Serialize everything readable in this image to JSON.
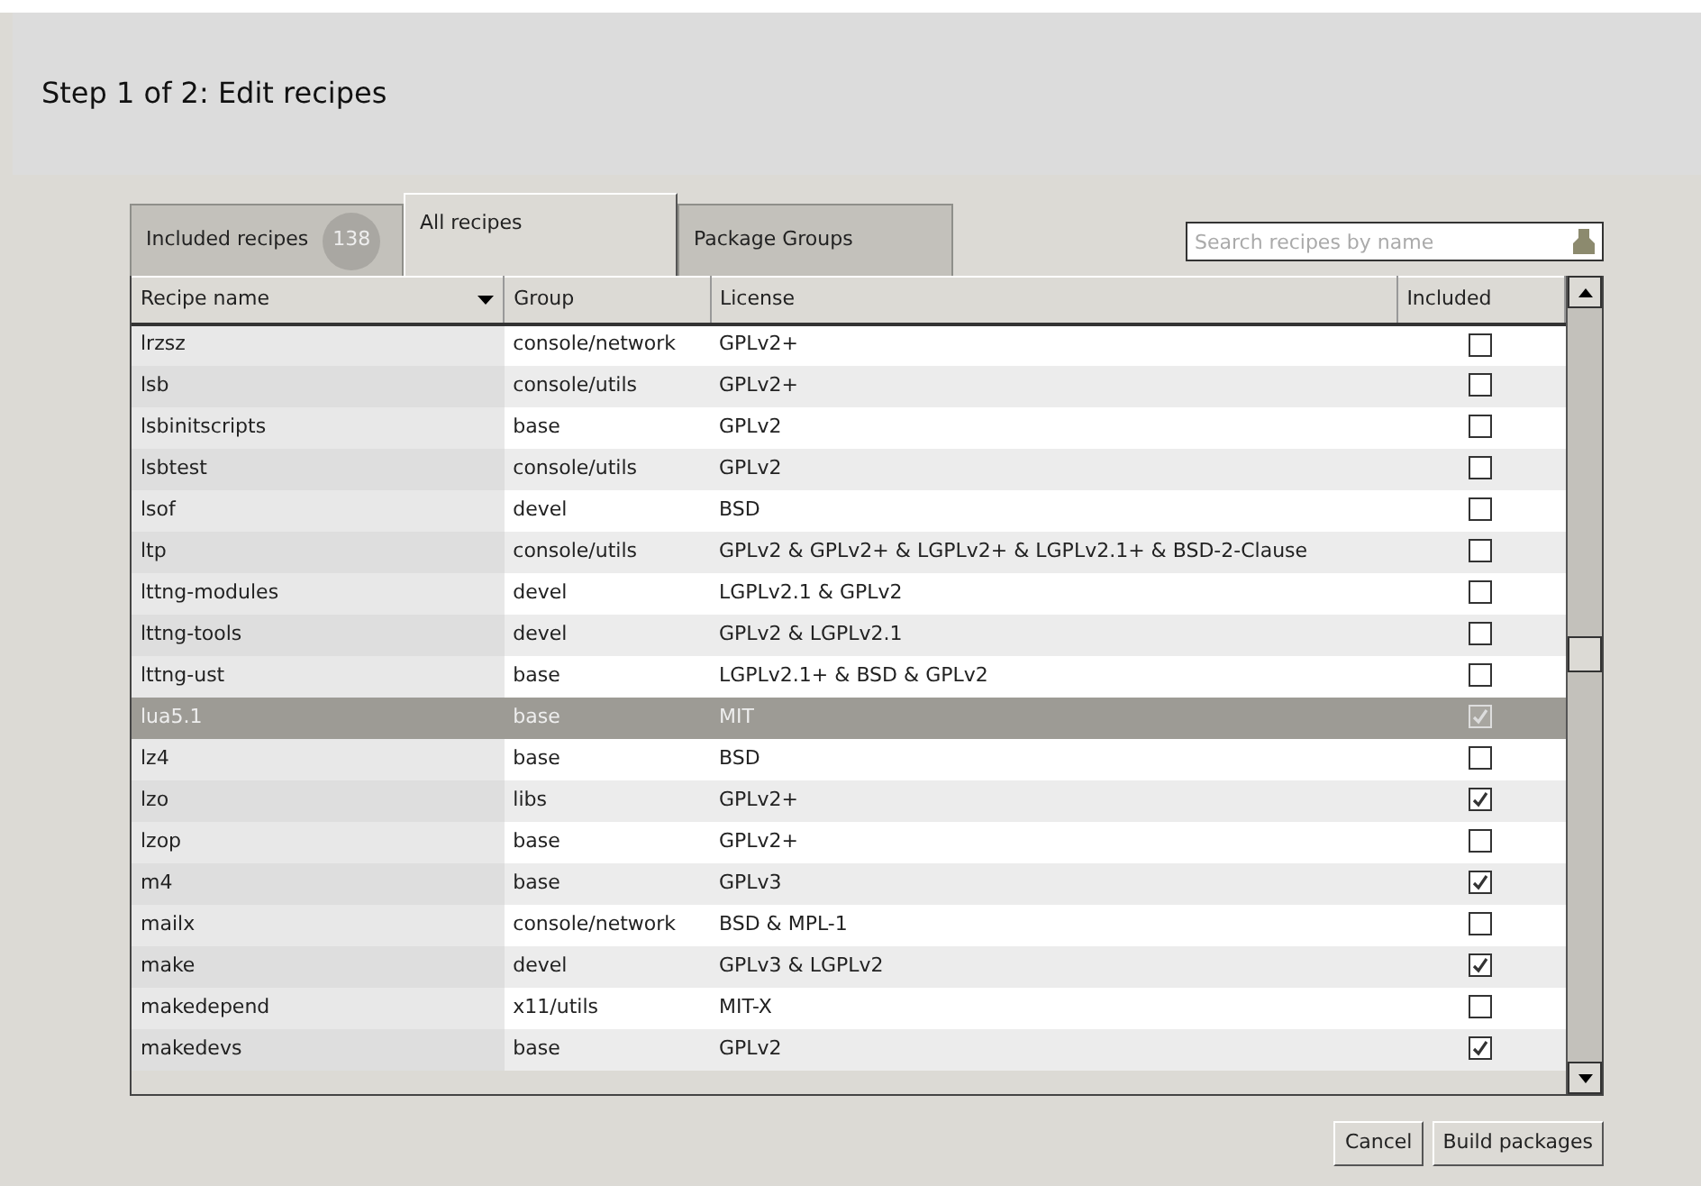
{
  "header": {
    "title": "Step 1 of 2: Edit recipes"
  },
  "tabs": [
    {
      "label": "Included recipes",
      "badge": "138",
      "selected": false
    },
    {
      "label": "All recipes",
      "selected": true
    },
    {
      "label": "Package Groups",
      "selected": false
    }
  ],
  "search": {
    "placeholder": "Search recipes by name"
  },
  "table": {
    "columns": [
      {
        "label": "Recipe name",
        "sorted": true
      },
      {
        "label": "Group",
        "sorted": false
      },
      {
        "label": "License",
        "sorted": false
      },
      {
        "label": "Included",
        "sorted": false
      }
    ],
    "rows": [
      {
        "name": "lrzsz",
        "group": "console/network",
        "license": "GPLv2+",
        "included": false,
        "selected": false
      },
      {
        "name": "lsb",
        "group": "console/utils",
        "license": "GPLv2+",
        "included": false,
        "selected": false
      },
      {
        "name": "lsbinitscripts",
        "group": "base",
        "license": "GPLv2",
        "included": false,
        "selected": false
      },
      {
        "name": "lsbtest",
        "group": "console/utils",
        "license": "GPLv2",
        "included": false,
        "selected": false
      },
      {
        "name": "lsof",
        "group": "devel",
        "license": "BSD",
        "included": false,
        "selected": false
      },
      {
        "name": "ltp",
        "group": "console/utils",
        "license": "GPLv2 & GPLv2+ & LGPLv2+ & LGPLv2.1+ & BSD-2-Clause",
        "included": false,
        "selected": false
      },
      {
        "name": "lttng-modules",
        "group": "devel",
        "license": "LGPLv2.1 & GPLv2",
        "included": false,
        "selected": false
      },
      {
        "name": "lttng-tools",
        "group": "devel",
        "license": "GPLv2 & LGPLv2.1",
        "included": false,
        "selected": false
      },
      {
        "name": "lttng-ust",
        "group": "base",
        "license": "LGPLv2.1+ & BSD & GPLv2",
        "included": false,
        "selected": false
      },
      {
        "name": "lua5.1",
        "group": "base",
        "license": "MIT",
        "included": true,
        "selected": true
      },
      {
        "name": "lz4",
        "group": "base",
        "license": "BSD",
        "included": false,
        "selected": false
      },
      {
        "name": "lzo",
        "group": "libs",
        "license": "GPLv2+",
        "included": true,
        "selected": false
      },
      {
        "name": "lzop",
        "group": "base",
        "license": "GPLv2+",
        "included": false,
        "selected": false
      },
      {
        "name": "m4",
        "group": "base",
        "license": "GPLv3",
        "included": true,
        "selected": false
      },
      {
        "name": "mailx",
        "group": "console/network",
        "license": "BSD & MPL-1",
        "included": false,
        "selected": false
      },
      {
        "name": "make",
        "group": "devel",
        "license": "GPLv3 & LGPLv2",
        "included": true,
        "selected": false
      },
      {
        "name": "makedepend",
        "group": "x11/utils",
        "license": "MIT-X",
        "included": false,
        "selected": false
      },
      {
        "name": "makedevs",
        "group": "base",
        "license": "GPLv2",
        "included": true,
        "selected": false
      }
    ]
  },
  "buttons": [
    {
      "label": "Cancel"
    },
    {
      "label": "Build packages"
    }
  ]
}
